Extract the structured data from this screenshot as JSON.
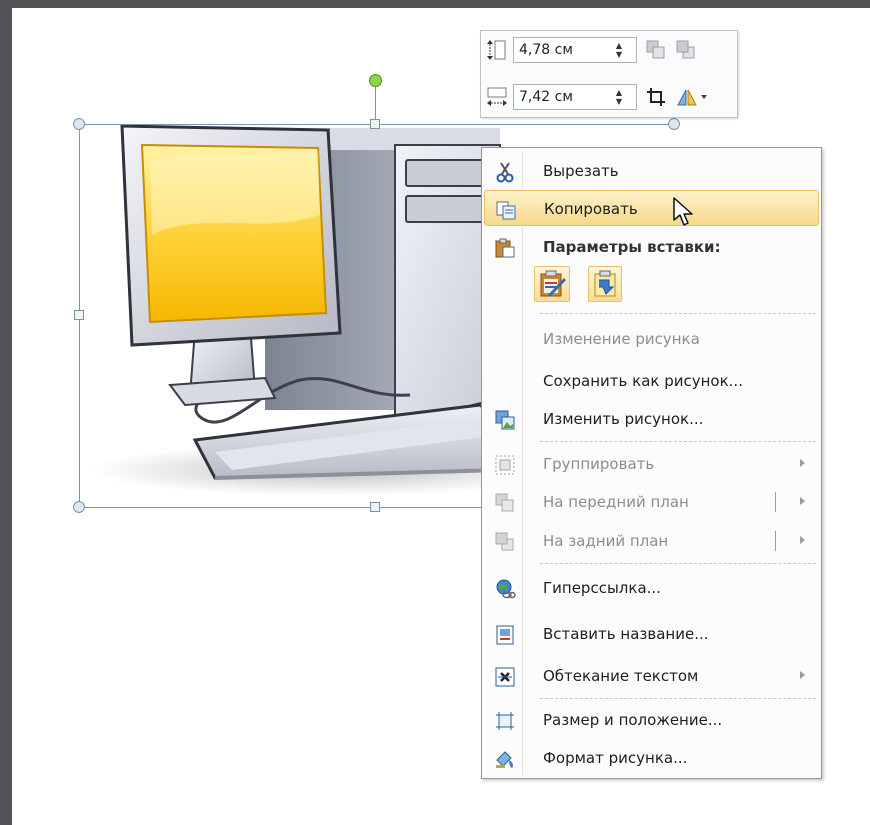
{
  "mini_toolbar": {
    "height_value": "4,78 см",
    "width_value": "7,42 см",
    "icons": [
      "shape-height-icon",
      "shape-width-icon",
      "bring-forward-icon",
      "send-backward-icon",
      "crop-icon",
      "rotate-icon"
    ]
  },
  "context_menu": {
    "cut": "Вырезать",
    "copy": "Копировать",
    "paste_options": "Параметры вставки:",
    "change_picture_disabled": "Изменение рисунка",
    "save_as_picture": "Сохранить как рисунок...",
    "change_picture": "Изменить рисунок...",
    "group": "Группировать",
    "bring_to_front": "На передний план",
    "send_to_back": "На задний план",
    "hyperlink": "Гиперссылка...",
    "insert_caption": "Вставить название...",
    "text_wrapping": "Обтекание текстом",
    "size_position": "Размер и положение...",
    "format_picture": "Формат рисунка..."
  },
  "colors": {
    "background": "#545257",
    "menu_hover": "#f7d98a",
    "selection": "#7e96a8",
    "rotate_handle": "#8cd64a"
  }
}
